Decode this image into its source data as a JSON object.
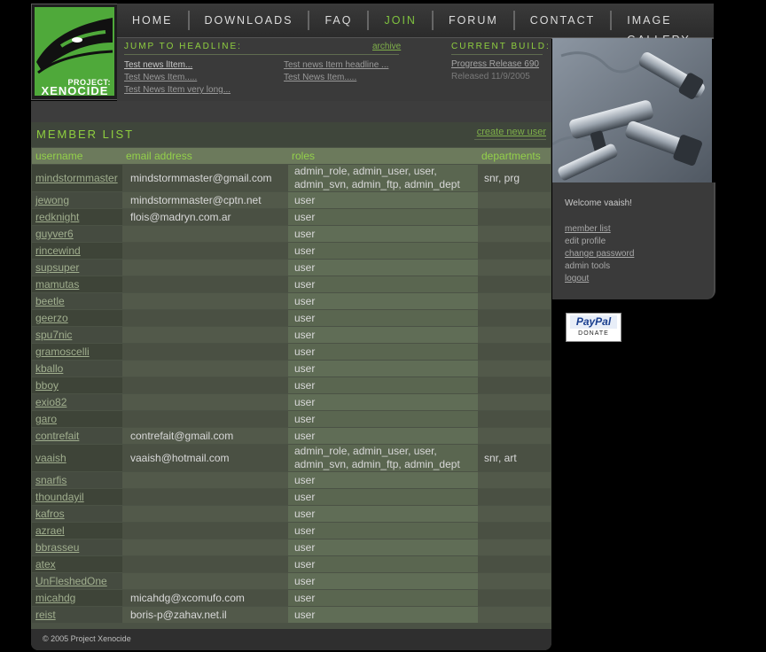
{
  "logo": {
    "line1": "PROJECT:",
    "line2": "XENOCIDE"
  },
  "nav": [
    "HOME",
    "DOWNLOADS",
    "FAQ",
    "JOIN",
    "FORUM",
    "CONTACT",
    "IMAGE GALLERY"
  ],
  "nav_active": "JOIN",
  "headlines": {
    "title": "JUMP TO HEADLINE:",
    "archive": "archive",
    "col1": [
      "Test news lItem...",
      "Test News Item.....",
      "Test News Item very long..."
    ],
    "col2": [
      "Test news Item headline ...",
      "Test News Item....."
    ]
  },
  "build": {
    "title": "CURRENT BUILD:",
    "link": "Progress Release 690",
    "date": "Released 11/9/2005"
  },
  "member_list": {
    "title": "MEMBER LIST",
    "create_link": "create new user",
    "headers": [
      "username",
      "email address",
      "roles",
      "departments"
    ],
    "rows": [
      {
        "username": "mindstormmaster",
        "email": "mindstormmaster@gmail.com",
        "roles": "admin_role, admin_user, user, admin_svn, admin_ftp, admin_dept",
        "departments": "snr, prg"
      },
      {
        "username": "jewong",
        "email": "mindstormmaster@cptn.net",
        "roles": "user",
        "departments": ""
      },
      {
        "username": "redknight",
        "email": "flois@madryn.com.ar",
        "roles": "user",
        "departments": ""
      },
      {
        "username": "guyver6",
        "email": "",
        "roles": "user",
        "departments": ""
      },
      {
        "username": "rincewind",
        "email": "",
        "roles": "user",
        "departments": ""
      },
      {
        "username": "supsuper",
        "email": "",
        "roles": "user",
        "departments": ""
      },
      {
        "username": "mamutas",
        "email": "",
        "roles": "user",
        "departments": ""
      },
      {
        "username": "beetle",
        "email": "",
        "roles": "user",
        "departments": ""
      },
      {
        "username": "geerzo",
        "email": "",
        "roles": "user",
        "departments": ""
      },
      {
        "username": "spu7nic",
        "email": "",
        "roles": "user",
        "departments": ""
      },
      {
        "username": "gramoscelli",
        "email": "",
        "roles": "user",
        "departments": ""
      },
      {
        "username": "kballo",
        "email": "",
        "roles": "user",
        "departments": ""
      },
      {
        "username": "bboy",
        "email": "",
        "roles": "user",
        "departments": ""
      },
      {
        "username": "exio82",
        "email": "",
        "roles": "user",
        "departments": ""
      },
      {
        "username": "garo",
        "email": "",
        "roles": "user",
        "departments": ""
      },
      {
        "username": "contrefait",
        "email": "contrefait@gmail.com",
        "roles": "user",
        "departments": ""
      },
      {
        "username": "vaaish",
        "email": "vaaish@hotmail.com",
        "roles": "admin_role, admin_user, user, admin_svn, admin_ftp, admin_dept",
        "departments": "snr, art"
      },
      {
        "username": "snarfis",
        "email": "",
        "roles": "user",
        "departments": ""
      },
      {
        "username": "thoundayil",
        "email": "",
        "roles": "user",
        "departments": ""
      },
      {
        "username": "kafros",
        "email": "",
        "roles": "user",
        "departments": ""
      },
      {
        "username": "azrael",
        "email": "",
        "roles": "user",
        "departments": ""
      },
      {
        "username": "bbrasseu",
        "email": "",
        "roles": "user",
        "departments": ""
      },
      {
        "username": "atex",
        "email": "",
        "roles": "user",
        "departments": ""
      },
      {
        "username": "UnFleshedOne",
        "email": "",
        "roles": "user",
        "departments": ""
      },
      {
        "username": "micahdg",
        "email": "micahdg@xcomufo.com",
        "roles": "user",
        "departments": ""
      },
      {
        "username": "reist",
        "email": "boris-p@zahav.net.il",
        "roles": "user",
        "departments": ""
      }
    ]
  },
  "footer": "© 2005 Project Xenocide",
  "sidebar": {
    "welcome": "Welcome vaaish!",
    "menu": [
      {
        "label": "member list",
        "link": true
      },
      {
        "label": "edit profile",
        "link": false
      },
      {
        "label": "change password",
        "link": true
      },
      {
        "label": "admin tools",
        "link": false
      },
      {
        "label": "logout",
        "link": true
      }
    ]
  },
  "paypal": {
    "brand": "PayPal",
    "action": "DONATE"
  }
}
